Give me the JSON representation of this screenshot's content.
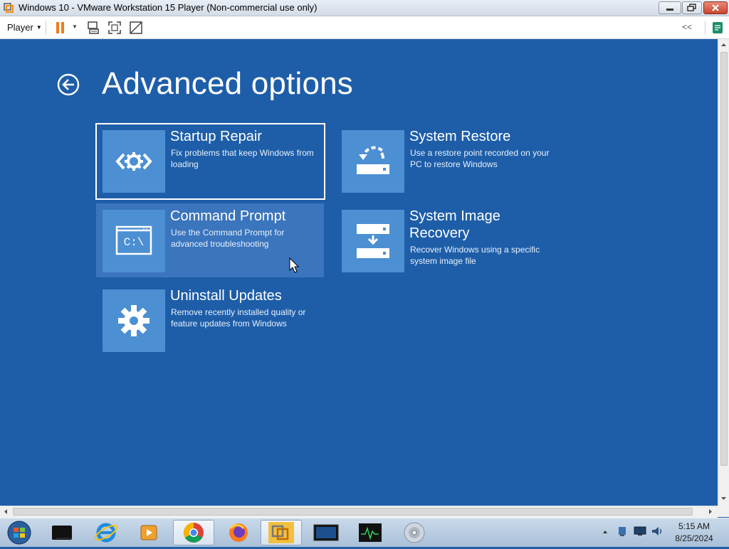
{
  "window": {
    "title": "Windows 10 - VMware Workstation 15 Player (Non-commercial use only)",
    "buttons": [
      "minimize-icon",
      "restore-icon",
      "close-icon"
    ]
  },
  "toolbar": {
    "player_label": "Player",
    "collapse_label": "<<",
    "icons": [
      "pause-icon",
      "send-ctrl-alt-del-icon",
      "full-screen-icon",
      "unity-icon",
      "notes-icon"
    ]
  },
  "guest": {
    "title": "Advanced options",
    "tiles": [
      {
        "title": "Startup Repair",
        "description": "Fix problems that keep Windows from loading",
        "icon": "startup-repair-icon",
        "state": "selected"
      },
      {
        "title": "System Restore",
        "description": "Use a restore point recorded on your PC to restore Windows",
        "icon": "system-restore-icon",
        "state": "normal"
      },
      {
        "title": "Command Prompt",
        "description": "Use the Command Prompt for advanced troubleshooting",
        "icon": "command-prompt-icon",
        "icon_text": "C:\\",
        "state": "hover"
      },
      {
        "title": "System Image Recovery",
        "description": "Recover Windows using a specific system image file",
        "icon": "system-image-recovery-icon",
        "state": "normal"
      },
      {
        "title": "Uninstall Updates",
        "description": "Remove recently installed quality or feature updates from Windows",
        "icon": "gear-icon",
        "state": "normal"
      }
    ]
  },
  "taskbar": {
    "apps": [
      "start-orb-icon",
      "terminal-icon",
      "internet-explorer-icon",
      "media-player-icon",
      "chrome-icon",
      "firefox-icon",
      "vmware-icon",
      "screen-icon",
      "activity-monitor-icon",
      "disc-icon"
    ],
    "tray": [
      "show-hidden-icons-chevron",
      "network-icon",
      "display-icon",
      "volume-icon"
    ],
    "time": "5:15 AM",
    "date": "8/25/2024"
  },
  "colors": {
    "guest_background": "#1e5ea9",
    "tile_icon_background": "#4c8fd3",
    "hover_tile_background": "#3a75bd"
  }
}
